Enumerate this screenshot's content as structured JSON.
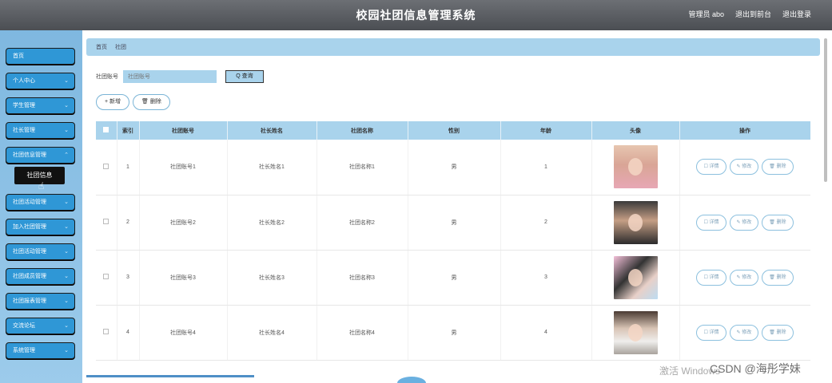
{
  "header": {
    "title": "校园社团信息管理系统",
    "admin_label": "管理员 abo",
    "exit_label": "退出到前台",
    "logout_label": "退出登录"
  },
  "sidebar": {
    "items": [
      {
        "label": "首页"
      },
      {
        "label": "个人中心"
      },
      {
        "label": "学生管理"
      },
      {
        "label": "社长管理"
      },
      {
        "label": "社团信息管理"
      },
      {
        "label": "社团活动管理"
      },
      {
        "label": "加入社团管理"
      },
      {
        "label": "社团活动管理"
      },
      {
        "label": "社团成员管理"
      },
      {
        "label": "社团报表管理"
      },
      {
        "label": "交流论坛"
      },
      {
        "label": "系统管理"
      }
    ],
    "active_subitem": "社团信息"
  },
  "breadcrumb": {
    "home": "首页",
    "current": "社团"
  },
  "search": {
    "label": "社团账号",
    "placeholder": "社团账号",
    "button": "Q 查询"
  },
  "actions": {
    "add": "+ 新增",
    "delete": "🗑 删除"
  },
  "table": {
    "headers": [
      "索引",
      "社团账号",
      "社长姓名",
      "社团名称",
      "性别",
      "年龄",
      "头像",
      "操作"
    ],
    "rows": [
      {
        "index": "1",
        "account": "社团账号1",
        "leader": "社长姓名1",
        "name": "社团名称1",
        "gender": "男",
        "age": "1"
      },
      {
        "index": "2",
        "account": "社团账号2",
        "leader": "社长姓名2",
        "name": "社团名称2",
        "gender": "男",
        "age": "2"
      },
      {
        "index": "3",
        "account": "社团账号3",
        "leader": "社长姓名3",
        "name": "社团名称3",
        "gender": "男",
        "age": "3"
      },
      {
        "index": "4",
        "account": "社团账号4",
        "leader": "社长姓名4",
        "name": "社团名称4",
        "gender": "男",
        "age": "4"
      }
    ],
    "ops": {
      "detail": "详情",
      "edit": "修改",
      "delete": "删除"
    }
  },
  "overlay": {
    "windows": "激活 Windows",
    "csdn": "CSDN @海彤学妹"
  }
}
